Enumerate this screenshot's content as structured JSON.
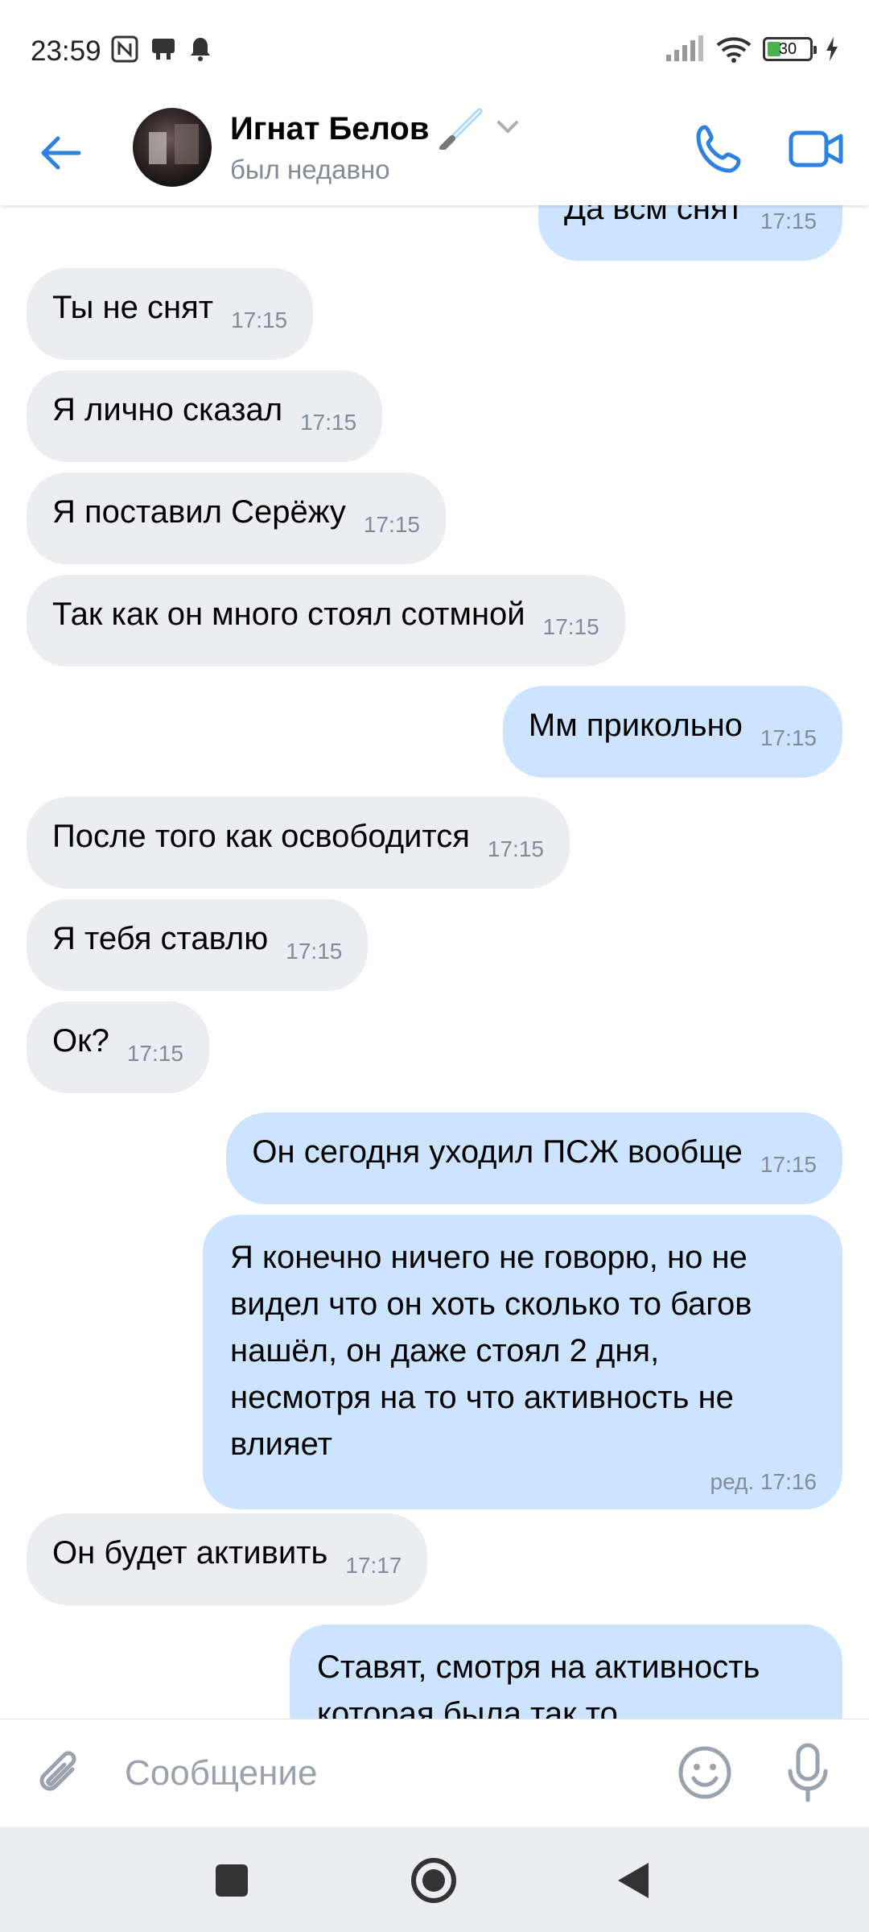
{
  "status_bar": {
    "time": "23:59",
    "battery": "30",
    "icons": [
      "nfc-icon",
      "notification-app-icon",
      "bell-icon",
      "signal-icon",
      "wifi-icon",
      "battery-icon",
      "charging-icon"
    ]
  },
  "header": {
    "name": "Игнат Белов",
    "status": "был недавно",
    "name_emoji": "lightsaber-emoji"
  },
  "messages": [
    {
      "dir": "out",
      "text": "Да всм снят",
      "time": "17:15"
    },
    {
      "dir": "in",
      "text": "Ты не снят",
      "time": "17:15"
    },
    {
      "dir": "in",
      "text": "Я лично сказал",
      "time": "17:15"
    },
    {
      "dir": "in",
      "text": "Я поставил Серёжу",
      "time": "17:15"
    },
    {
      "dir": "in",
      "text": "Так как он много стоял сотмной",
      "time": "17:15"
    },
    {
      "dir": "out",
      "text": "Мм прикольно",
      "time": "17:15"
    },
    {
      "dir": "in",
      "text": "После того как освободится",
      "time": "17:15"
    },
    {
      "dir": "in",
      "text": "Я тебя ставлю",
      "time": "17:15"
    },
    {
      "dir": "in",
      "text": "Ок?",
      "time": "17:15"
    },
    {
      "dir": "out",
      "text": "Он сегодня уходил ПСЖ вообще",
      "time": "17:15"
    },
    {
      "dir": "out",
      "lines": [
        "Я конечно ничего не говорю, но не",
        "видел что он хоть сколько то багов",
        "нашёл, он даже стоял 2 дня,",
        "несмотря на то что активность не",
        "влияет"
      ],
      "time": "ред. 17:16"
    },
    {
      "dir": "in",
      "text": "Он будет активить",
      "time": "17:17"
    },
    {
      "dir": "out",
      "lines": [
        "Ставят, смотря на активность",
        "которая была так то"
      ]
    }
  ],
  "composer": {
    "placeholder": "Сообщение"
  },
  "colors": {
    "accent": "#2d81e0",
    "incoming_bubble": "#ebedf0",
    "outgoing_bubble": "#cce4ff",
    "secondary_text": "#818c99"
  }
}
